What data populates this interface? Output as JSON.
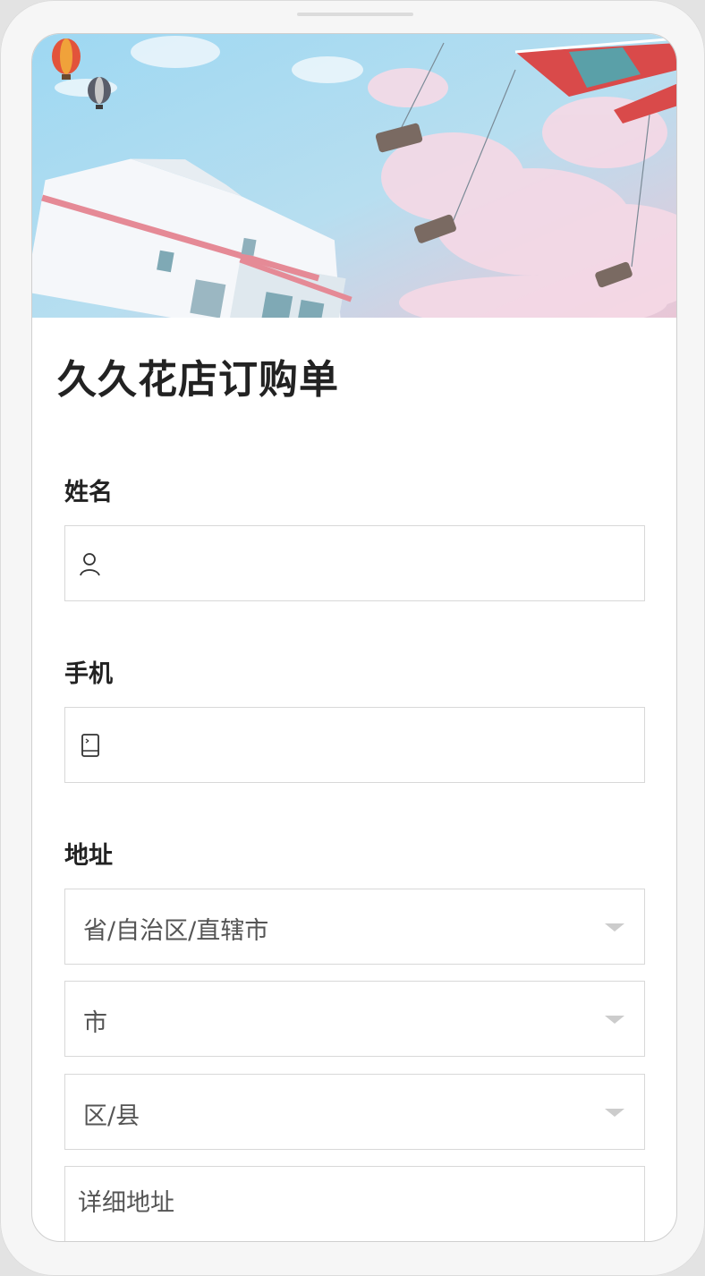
{
  "form": {
    "title": "久久花店订购单",
    "name_label": "姓名",
    "phone_label": "手机",
    "address_label": "地址",
    "province_select": "省/自治区/直辖市",
    "city_select": "市",
    "district_select": "区/县",
    "detail_address_placeholder": "详细地址"
  },
  "colors": {
    "background": "#ffffff",
    "text": "#222222",
    "border": "#d8d8d8",
    "caret": "#cccccc"
  },
  "icons": {
    "name_field": "person-icon",
    "phone_field": "phone-icon",
    "select_arrow": "caret-down-icon"
  }
}
